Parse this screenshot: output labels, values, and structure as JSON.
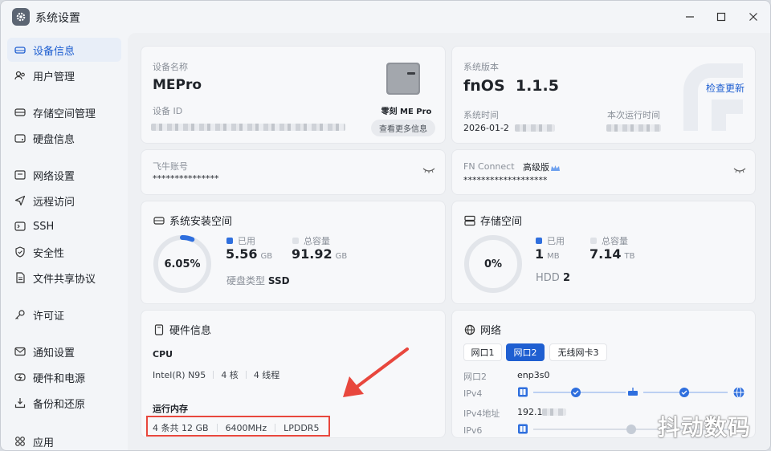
{
  "app": {
    "title": "系统设置"
  },
  "sidebar": {
    "items": [
      {
        "label": "设备信息",
        "icon": "device-icon",
        "active": true
      },
      {
        "label": "用户管理",
        "icon": "users-icon"
      },
      {
        "label": "存储空间管理",
        "icon": "storage-icon"
      },
      {
        "label": "硬盘信息",
        "icon": "disk-icon"
      },
      {
        "label": "网络设置",
        "icon": "network-icon"
      },
      {
        "label": "远程访问",
        "icon": "remote-icon"
      },
      {
        "label": "SSH",
        "icon": "ssh-icon"
      },
      {
        "label": "安全性",
        "icon": "shield-icon"
      },
      {
        "label": "文件共享协议",
        "icon": "file-share-icon"
      },
      {
        "label": "许可证",
        "icon": "key-icon"
      },
      {
        "label": "通知设置",
        "icon": "mail-icon"
      },
      {
        "label": "硬件和电源",
        "icon": "power-icon"
      },
      {
        "label": "备份和还原",
        "icon": "backup-icon"
      },
      {
        "label": "应用",
        "icon": "apps-icon"
      }
    ]
  },
  "device": {
    "name_label": "设备名称",
    "name": "MEPro",
    "id_label": "设备 ID",
    "model": "零刻 ME Pro",
    "more_button": "查看更多信息"
  },
  "system": {
    "version_label": "系统版本",
    "version": "fnOS  1.1.5",
    "update_link": "检查更新",
    "time_label": "系统时间",
    "time": "2026-01-2",
    "uptime_label": "本次运行时间"
  },
  "account": {
    "label": "飞牛账号",
    "value": "***************"
  },
  "fnconnect": {
    "label": "FN Connect",
    "edition": "高级版",
    "value": "*******************"
  },
  "sys_space": {
    "title": "系统安装空间",
    "percent_text": "6.05%",
    "percent": 6.05,
    "used_label": "已用",
    "used_value": "5.56",
    "used_unit": "GB",
    "total_label": "总容量",
    "total_value": "91.92",
    "total_unit": "GB",
    "disk_type_label": "硬盘类型",
    "disk_type": "SSD"
  },
  "storage": {
    "title": "存储空间",
    "percent_text": "0%",
    "percent": 0,
    "used_label": "已用",
    "used_value": "1",
    "used_unit": "MB",
    "total_label": "总容量",
    "total_value": "7.14",
    "total_unit": "TB",
    "hdd_label": "HDD",
    "hdd_count": "2"
  },
  "hardware": {
    "title": "硬件信息",
    "cpu_label": "CPU",
    "cpu_model": "Intel(R) N95",
    "cpu_cores": "4 核",
    "cpu_threads": "4 线程",
    "mem_label": "运行内存",
    "mem_size": "4 条共 12 GB",
    "mem_speed": "6400MHz",
    "mem_type": "LPDDR5"
  },
  "network": {
    "title": "网络",
    "tabs": [
      "网口1",
      "网口2",
      "无线网卡3"
    ],
    "active_tab": 1,
    "port_label": "网口2",
    "port_value": "enp3s0",
    "ipv4_label": "IPv4",
    "ipv4_addr_label": "IPv4地址",
    "ipv4_addr": "192.1",
    "ipv6_label": "IPv6"
  },
  "watermark": "抖动数码",
  "colors": {
    "accent": "#1f5fd1",
    "annotation": "#e8473d"
  }
}
